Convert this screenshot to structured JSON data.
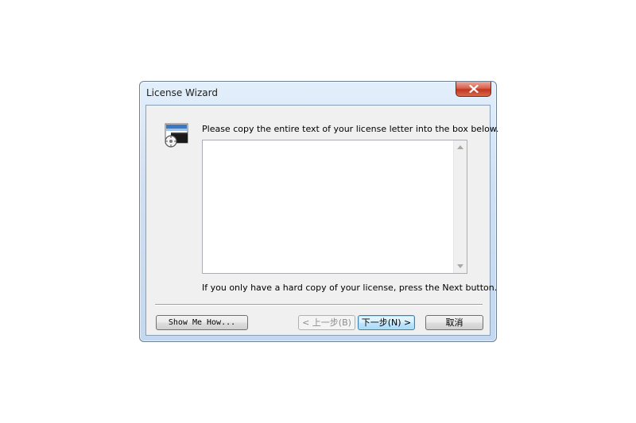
{
  "window": {
    "title": "License Wizard"
  },
  "content": {
    "instruction": "Please copy the entire text of your license letter into the box below.",
    "license_text": "",
    "hint": "If you only have a hard copy of your license, press the Next button."
  },
  "buttons": {
    "show_me_how": "Show Me How...",
    "back": "< 上一步(B)",
    "next": "下一步(N) >",
    "cancel": "取消"
  },
  "icons": {
    "close": "close-icon",
    "wizard": "license-wizard-icon",
    "scroll_up": "scroll-up-arrow-icon",
    "scroll_down": "scroll-down-arrow-icon"
  },
  "colors": {
    "close_button": "#c7412b",
    "title_bar": "#cfe0f3",
    "client_background": "#f0f0f0",
    "default_button_border": "#3c7fb1"
  }
}
